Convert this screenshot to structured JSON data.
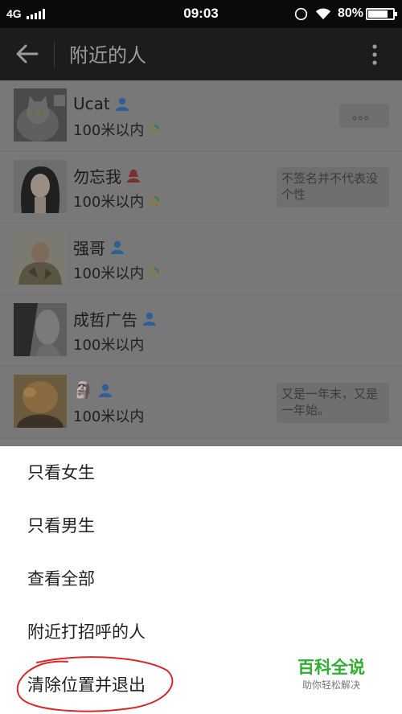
{
  "status_bar": {
    "network": "4G",
    "time": "09:03",
    "battery_percent": "80%",
    "battery_level": 0.8
  },
  "titlebar": {
    "title": "附近的人"
  },
  "people": [
    {
      "name": "Ucat",
      "gender": "male",
      "distance": "100米以内",
      "moments": true,
      "signature": "。。。"
    },
    {
      "name": "勿忘我",
      "gender": "female",
      "distance": "100米以内",
      "moments": true,
      "signature": "不签名并不代表没个性"
    },
    {
      "name": "强哥",
      "gender": "male",
      "distance": "100米以内",
      "moments": true,
      "signature": ""
    },
    {
      "name": "成哲广告",
      "gender": "male",
      "distance": "100米以内",
      "moments": false,
      "signature": ""
    },
    {
      "name": "🗿",
      "gender": "male",
      "distance": "100米以内",
      "moments": false,
      "signature": "又是一年末，又是一年始。"
    }
  ],
  "menu": {
    "items": [
      {
        "label": "只看女生"
      },
      {
        "label": "只看男生"
      },
      {
        "label": "查看全部"
      },
      {
        "label": "附近打招呼的人"
      },
      {
        "label": "清除位置并退出"
      }
    ]
  },
  "watermark": {
    "title": "百科全说",
    "subtitle": "助你轻松解决"
  },
  "colors": {
    "male_icon": "#3b7fc8",
    "female_icon": "#d9534f",
    "annotation_circle": "#d42a2a",
    "watermark": "#2fae34"
  }
}
